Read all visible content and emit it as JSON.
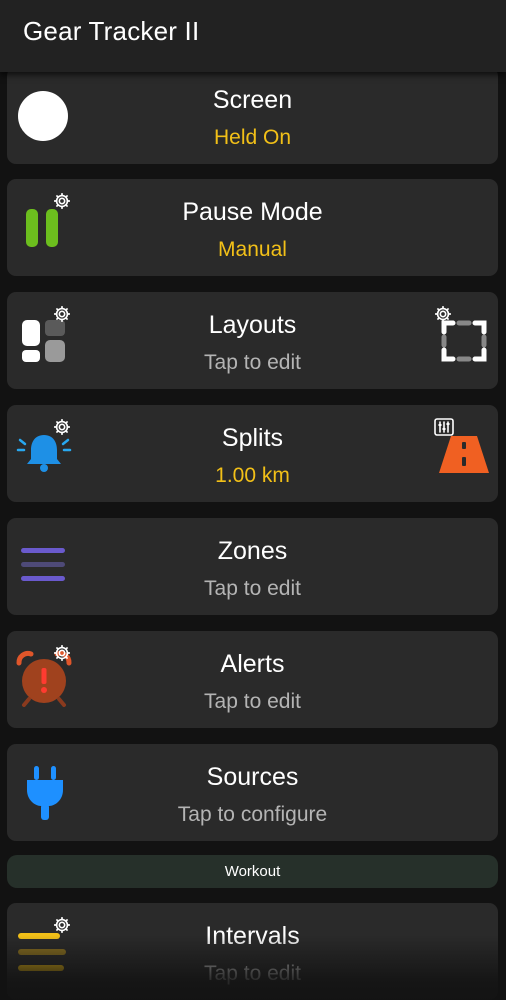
{
  "app": {
    "title": "Gear Tracker II"
  },
  "cards": [
    {
      "name": "screen",
      "label": "Screen",
      "value": "Held On",
      "icon": "circle-icon"
    },
    {
      "name": "pause-mode",
      "label": "Pause Mode",
      "value": "Manual",
      "icon": "pause-icon"
    },
    {
      "name": "layouts",
      "label": "Layouts",
      "value": "Tap to edit",
      "icon": "layout-icon"
    },
    {
      "name": "splits",
      "label": "Splits",
      "value": "1.00 km",
      "icon": "bell-icon"
    },
    {
      "name": "zones",
      "label": "Zones",
      "value": "Tap to edit",
      "icon": "zones-icon"
    },
    {
      "name": "alerts",
      "label": "Alerts",
      "value": "Tap to edit",
      "icon": "alarm-icon"
    },
    {
      "name": "sources",
      "label": "Sources",
      "value": "Tap to configure",
      "icon": "plug-icon"
    },
    {
      "name": "intervals",
      "label": "Intervals",
      "value": "Tap to edit",
      "icon": "intervals-icon"
    }
  ],
  "section": {
    "label": "Workout"
  },
  "colors": {
    "accent_yellow": "#f2c018",
    "card_bg": "#2a2a2a",
    "pause_green": "#6cbe1e",
    "bell_blue": "#1e90e6",
    "zones_purple": "#6a5acd",
    "alarm_brown": "#a0421e",
    "plug_blue": "#1e90ff",
    "road_orange": "#f06022"
  }
}
